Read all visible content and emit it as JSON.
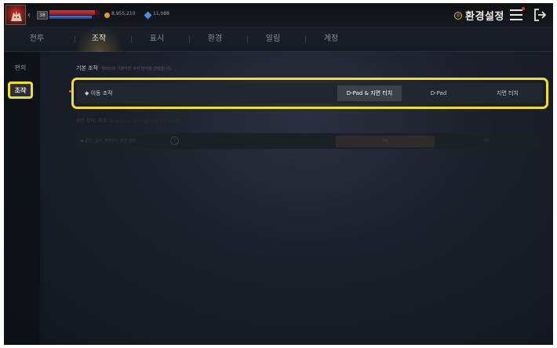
{
  "header": {
    "level": "38",
    "gold": "8,955,210",
    "gems": "11,088",
    "settings_title": "환경설정",
    "hp_fraction": 0.9,
    "mp_fraction": 0.85
  },
  "tabs": [
    {
      "label": "전투",
      "active": false
    },
    {
      "label": "조작",
      "active": true
    },
    {
      "label": "표시",
      "active": false
    },
    {
      "label": "환경",
      "active": false
    },
    {
      "label": "알림",
      "active": false
    },
    {
      "label": "계정",
      "active": false
    }
  ],
  "sidebar": {
    "items": [
      {
        "label": "편의",
        "active": false
      },
      {
        "label": "조작",
        "active": true
      }
    ]
  },
  "main": {
    "section_title": "기본 조작",
    "section_desc": "캐릭터의 기본적인 조작 방식을 선택합니다.",
    "move_control": {
      "label": "◆ 이동 조작",
      "options": [
        "D-Pad & 지면 터치",
        "D-Pad",
        "지면 터치"
      ],
      "selected_index": 0
    },
    "sub_section_title": "화면 확대, 축소",
    "sub_section_desc": "화면을 확대, 축소하여 더 넓은 영역을 볼 수 있습니다.",
    "zoom_toggle": {
      "label": "◆ 줌인, 줌아, 회전하는 화면 전환",
      "help": "?",
      "on_label": "On",
      "off_label": "Off"
    }
  },
  "colors": {
    "highlight": "#f0e020",
    "accent_gold": "#e0c060"
  }
}
